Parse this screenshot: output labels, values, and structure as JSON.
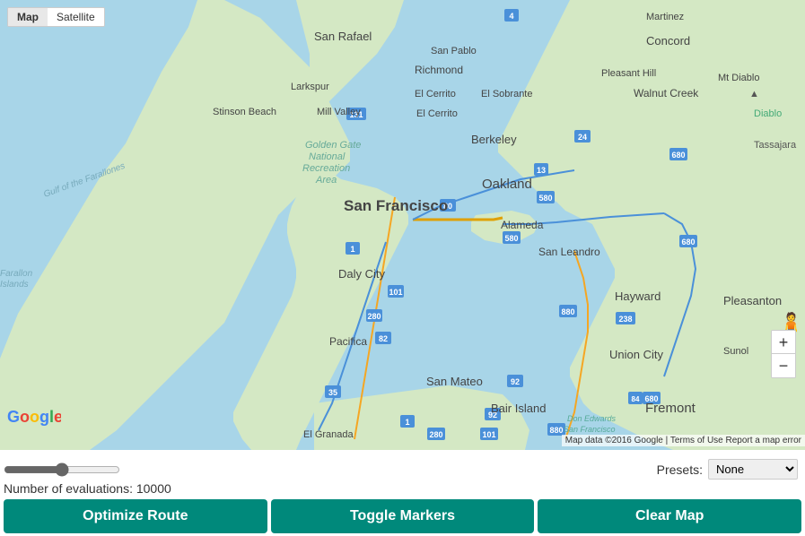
{
  "map": {
    "type_buttons": [
      {
        "label": "Map",
        "active": true
      },
      {
        "label": "Satellite",
        "active": false
      }
    ],
    "zoom_in_label": "+",
    "zoom_out_label": "−",
    "attribution": "Map data ©2016 Google | Terms of Use   Report a map error",
    "center": "San Francisco Bay Area"
  },
  "controls": {
    "presets_label": "Presets:",
    "presets_options": [
      "None"
    ],
    "presets_selected": "None",
    "evaluations_label": "Number of evaluations: 10000",
    "slider_value": 50
  },
  "buttons": {
    "optimize": "Optimize Route",
    "toggle": "Toggle Markers",
    "clear": "Clear Map"
  }
}
